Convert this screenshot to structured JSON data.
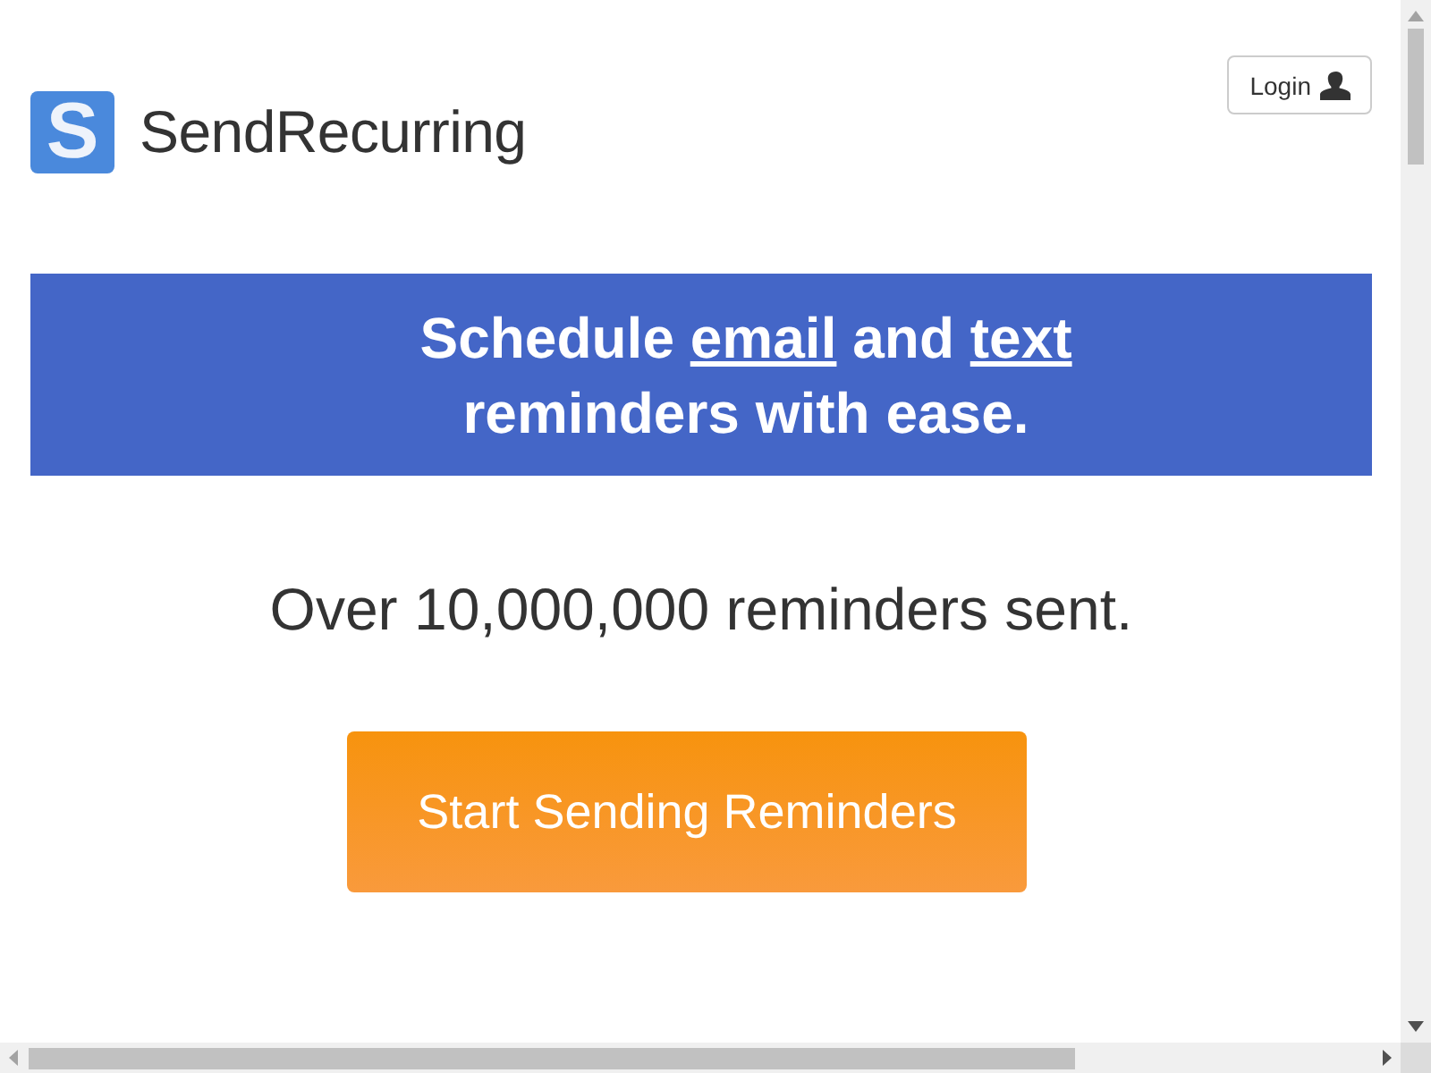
{
  "logo": {
    "letter": "S",
    "name": "SendRecurring"
  },
  "login_button": {
    "label": "Login"
  },
  "banner": {
    "lines": [
      [
        {
          "kind": "text",
          "text": "Schedule "
        },
        {
          "kind": "link",
          "text": "email"
        },
        {
          "kind": "text",
          "text": " and "
        },
        {
          "kind": "link",
          "text": "text"
        }
      ],
      [
        {
          "kind": "text",
          "text": "reminders with ease."
        }
      ]
    ]
  },
  "stat": "Over 10,000,000 reminders sent.",
  "cta_button": {
    "label": "Start Sending Reminders"
  }
}
